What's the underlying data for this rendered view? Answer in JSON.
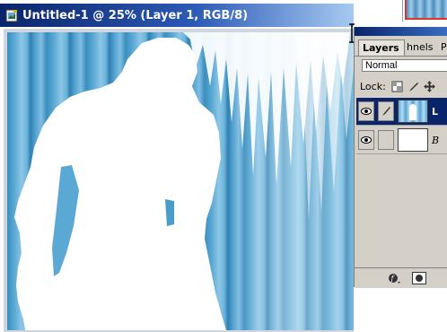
{
  "document": {
    "title": "Untitled-1 @ 25% (Layer 1, RGB/8)"
  },
  "layers_panel": {
    "tabs": [
      {
        "label": "Layers",
        "active": true
      },
      {
        "label": "hnels",
        "active": false
      },
      {
        "label": "P",
        "active": false
      }
    ],
    "blend_mode": "Normal",
    "lock_label": "Lock:",
    "layers": [
      {
        "name": "L",
        "selected": true,
        "visible": true
      },
      {
        "name": "B",
        "selected": false,
        "visible": true
      }
    ]
  },
  "icons": {
    "document": "photoshop-document-icon",
    "eye": "eye-icon",
    "brush": "brush-icon",
    "layer_style": "layer-style-icon",
    "layer_mask": "layer-mask-icon"
  },
  "colors": {
    "titlebar_start": "#0a246a",
    "titlebar_end": "#a6caf0",
    "panel_bg": "#d4d0c8",
    "selected_row": "#0a246a",
    "canvas_blue": "#3a8fbe"
  }
}
